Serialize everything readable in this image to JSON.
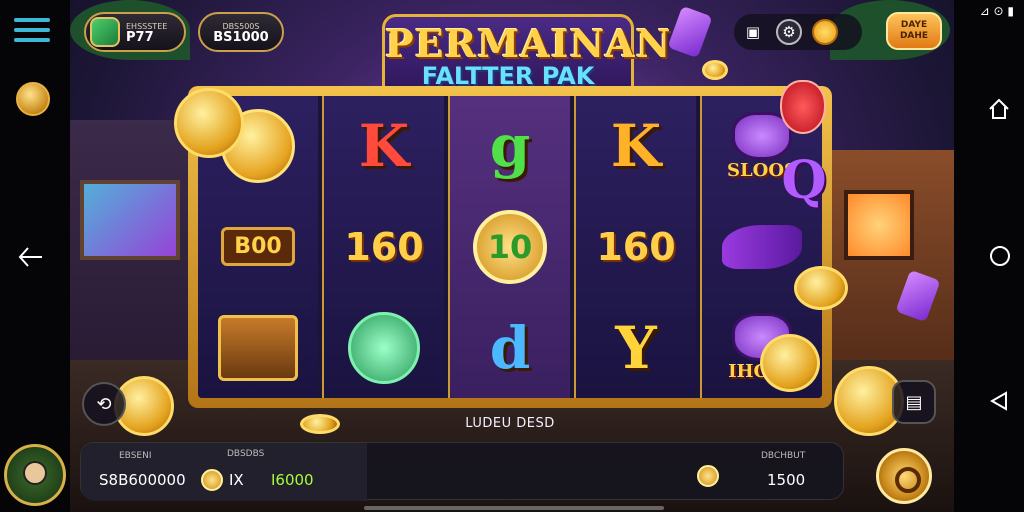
{
  "hud": {
    "player_label": "EHSSSTEE",
    "player_value": "P77",
    "balance_label": "DBS500S",
    "balance_value": "BS1000",
    "daily_button": "DAYE DAHE"
  },
  "logo": {
    "line1": "PERMAINAN",
    "line2": "FALTTER PAK"
  },
  "reels": [
    {
      "symbols": [
        "fruit-coin",
        "B00",
        "treasure-chest"
      ],
      "box_label": "B00"
    },
    {
      "symbols": [
        "K",
        "160",
        "green-gem"
      ],
      "letter": "K",
      "number": "160"
    },
    {
      "symbols": [
        "g",
        "10",
        "d"
      ],
      "letter": "g",
      "number": "10",
      "letter2": "d"
    },
    {
      "symbols": [
        "K",
        "160",
        "Y"
      ],
      "letter": "K",
      "number": "160",
      "letter2": "Y"
    },
    {
      "symbols": [
        "cat-slots",
        "purple-horn",
        "cat-slots"
      ],
      "label1": "SLOOS",
      "label2": "IHOSE"
    }
  ],
  "center_text": "LUDEU DESD",
  "bottom": {
    "win_label": "EBSENI",
    "win_value": "S8B600000",
    "bet_label": "DBSDBS",
    "bet_mul": "IX",
    "bet_value": "I6000",
    "auto_label": "DBCHBUT",
    "auto_value": "1500"
  },
  "system": {
    "status_icons": "⊿ ⊙ ▮"
  },
  "colors": {
    "accent_gold": "#e5b339",
    "background_purple": "#3c2463",
    "bet_green": "#a6ff3a"
  }
}
